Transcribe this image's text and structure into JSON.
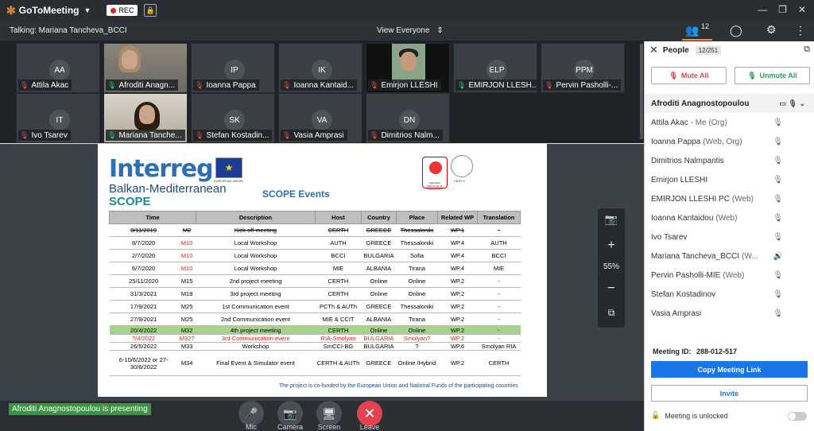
{
  "app": {
    "title": "GoToMeeting",
    "rec_label": "REC"
  },
  "window_controls": [
    "—",
    "❐",
    "✕"
  ],
  "talking": "Talking: Mariana Tancheva_BCCI",
  "view_selector": "View Everyone",
  "top_right": {
    "people_count": "12"
  },
  "tiles": [
    {
      "initials": "AA",
      "name": "Attila Akac",
      "mic": "muted",
      "video": false
    },
    {
      "initials": "",
      "name": "Afroditi Anagn...",
      "mic": "on",
      "video": true
    },
    {
      "initials": "IP",
      "name": "Ioanna Pappa",
      "mic": "muted",
      "video": false
    },
    {
      "initials": "IK",
      "name": "Ioanna Kantaid...",
      "mic": "muted",
      "video": false
    },
    {
      "initials": "",
      "name": "Emirjon LLESHI",
      "mic": "muted",
      "video": true
    },
    {
      "initials": "ELP",
      "name": "EMIRJON LLESH...",
      "mic": "on",
      "video": false
    },
    {
      "initials": "PPM",
      "name": "Pervin Pasholli-...",
      "mic": "muted",
      "video": false
    },
    {
      "initials": "IT",
      "name": "Ivo Tsarev",
      "mic": "muted",
      "video": false
    },
    {
      "initials": "",
      "name": "Mariana Tanche...",
      "mic": "on",
      "video": true
    },
    {
      "initials": "SK",
      "name": "Stefan Kostadin...",
      "mic": "muted",
      "video": false
    },
    {
      "initials": "VA",
      "name": "Vasia Amprasi",
      "mic": "muted",
      "video": false
    },
    {
      "initials": "DN",
      "name": "Dimitrios Nalm...",
      "mic": "muted",
      "video": false
    }
  ],
  "slide": {
    "brand": "Interreg",
    "eu_label": "EUROPEAN UNION",
    "program": "Balkan-Mediterranean",
    "project": "SCOPE",
    "title": "SCOPE Events",
    "logo2_label": "HELLENIC INSTITUTE OF TRANSPORT",
    "logo3_label": "CERTH",
    "headers": [
      "Time",
      "",
      "Description",
      "Host",
      "Country",
      "Place",
      "Related WP",
      "Translation"
    ],
    "rows": [
      {
        "date": "8/11/2019",
        "m": "M2",
        "desc": "Kick off meeting",
        "host": "CERTH",
        "country": "GREECE",
        "place": "Thessaloniki",
        "wp": "WP.1",
        "tr": "-",
        "style": "strike"
      },
      {
        "date": "8/7/2020",
        "m": "M10",
        "desc": "Local Workshop",
        "host": "AUTH",
        "country": "GREECE",
        "place": "Thessaloniki",
        "wp": "WP.4",
        "tr": "AUTH",
        "style": "redm"
      },
      {
        "date": "2/7/2020",
        "m": "M10",
        "desc": "Local Workshop",
        "host": "BCCI",
        "country": "BULGARIA",
        "place": "Sofia",
        "wp": "WP.4",
        "tr": "BCCI",
        "style": "redm"
      },
      {
        "date": "6/7/2020",
        "m": "M10",
        "desc": "Local Workshop",
        "host": "MIE",
        "country": "ALBANIA",
        "place": "Tirana",
        "wp": "WP.4",
        "tr": "MIE",
        "style": "redm"
      },
      {
        "date": "25/11/2020",
        "m": "M15",
        "desc": "2nd project meeting",
        "host": "CERTH",
        "country": "Online",
        "place": "Online",
        "wp": "WP.2",
        "tr": "-",
        "style": ""
      },
      {
        "date": "31/3/2021",
        "m": "M19",
        "desc": "3rd project meeting",
        "host": "CERTH",
        "country": "Online",
        "place": "Online",
        "wp": "WP.2",
        "tr": "-",
        "style": ""
      },
      {
        "date": "17/9/2021",
        "m": "M25",
        "desc": "1st Communication event",
        "host": "PCTh & AUTh",
        "country": "GREECE",
        "place": "Thessaloniki",
        "wp": "WP.2",
        "tr": "-",
        "style": ""
      },
      {
        "date": "27/9/2021",
        "m": "M25",
        "desc": "2nd Communication event",
        "host": "MIE & CCIT",
        "country": "ALBANIA",
        "place": "Tirana",
        "wp": "WP.2",
        "tr": "-",
        "style": ""
      },
      {
        "date": "20/4/2022",
        "m": "M32",
        "desc": "4th project meeting",
        "host": "CERTH",
        "country": "Online",
        "place": "Online",
        "wp": "WP.2",
        "tr": "-",
        "style": "green"
      },
      {
        "date": "?/4/2022",
        "m": "M32?",
        "desc": "3rd Communication event",
        "host": "RIA-Smolyan",
        "country": "BULGARIA",
        "place": "Smolyan?",
        "wp": "WP.2",
        "tr": "-",
        "style": "redrow"
      },
      {
        "date": "26/5/2022",
        "m": "M33",
        "desc": "Workshop",
        "host": "SmCCI-BG",
        "country": "BULGARIA",
        "place": "?",
        "wp": "WP.6",
        "tr": "Smolyan RIA",
        "style": "small"
      },
      {
        "date": "6-10/6/2022 or 27-30/6/2022",
        "m": "M34",
        "desc": "Final Event & Simulator event",
        "host": "CERTH & AUTh",
        "country": "GREECE",
        "place": "Online /Hybrid",
        "wp": "WP.2",
        "tr": "CERTH",
        "style": "tall"
      }
    ],
    "footer": "The project is co-funded by the European Union and National Funds of the participating countries"
  },
  "zoom": {
    "level": "55%"
  },
  "presenting": "Afroditi Anagnostopoulou is presenting",
  "controls": [
    {
      "label": "Mic",
      "icon": "mic-off-icon"
    },
    {
      "label": "Camera",
      "icon": "camera-off-icon"
    },
    {
      "label": "Screen",
      "icon": "screen-share-off-icon"
    },
    {
      "label": "Leave",
      "icon": "leave-icon"
    }
  ],
  "panel": {
    "title": "People",
    "count": "12/251",
    "mute_all": "Mute All",
    "unmute_all": "Unmute All",
    "people": [
      {
        "name": "Afroditi Anagnostopoulou",
        "role": "",
        "mic": "on",
        "me": true
      },
      {
        "name": "Attila Akac",
        "role": "- Me (Org)",
        "mic": "muted"
      },
      {
        "name": "Ioanna Pappa",
        "role": "(Web, Org)",
        "mic": "muted"
      },
      {
        "name": "Dimitrios Nalmpantis",
        "role": "",
        "mic": "muted"
      },
      {
        "name": "Emirjon LLESHI",
        "role": "",
        "mic": "muted"
      },
      {
        "name": "EMIRJON LLESHI PC",
        "role": "(Web)",
        "mic": "on"
      },
      {
        "name": "Ioanna Kantaidou",
        "role": "(Web)",
        "mic": "muted"
      },
      {
        "name": "Ivo Tsarev",
        "role": "",
        "mic": "muted"
      },
      {
        "name": "Mariana Tancheva_BCCI",
        "role": "(W...",
        "mic": "speaking"
      },
      {
        "name": "Pervin Pasholli-MIE",
        "role": "(Web)",
        "mic": "muted"
      },
      {
        "name": "Stefan Kostadinov",
        "role": "",
        "mic": "muted"
      },
      {
        "name": "Vasia Amprasi",
        "role": "",
        "mic": "muted"
      }
    ],
    "meeting_id_label": "Meeting ID:",
    "meeting_id": "288-012-517",
    "copy_link": "Copy Meeting Link",
    "invite": "Invite",
    "lock_status": "Meeting is unlocked"
  }
}
